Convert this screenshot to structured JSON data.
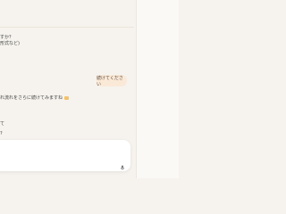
{
  "conversation": {
    "assistant_lines": [
      "すか？",
      "形式など)",
      "れ流れをさらに続けてみますね",
      "て",
      "?"
    ],
    "user_message": "続けてください"
  },
  "composer": {
    "value": "",
    "mic_icon": "microphone-icon"
  },
  "colors": {
    "background": "#f6f3ee",
    "user_bubble": "#fbe9d8",
    "composer": "#ffffff"
  }
}
